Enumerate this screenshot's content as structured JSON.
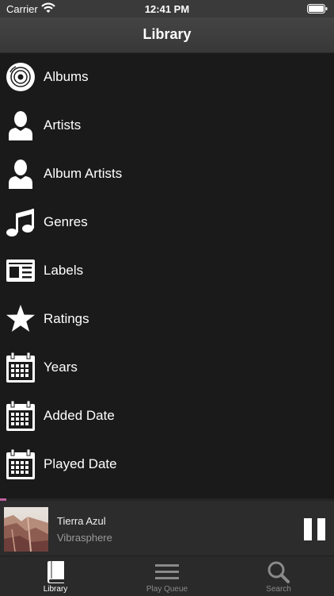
{
  "status_bar": {
    "carrier": "Carrier",
    "time": "12:41 PM"
  },
  "nav": {
    "title": "Library"
  },
  "list": {
    "items": [
      {
        "label": "Albums",
        "icon": "album-icon"
      },
      {
        "label": "Artists",
        "icon": "person-icon"
      },
      {
        "label": "Album Artists",
        "icon": "person-icon"
      },
      {
        "label": "Genres",
        "icon": "music-note-icon"
      },
      {
        "label": "Labels",
        "icon": "label-icon"
      },
      {
        "label": "Ratings",
        "icon": "star-icon"
      },
      {
        "label": "Years",
        "icon": "calendar-icon"
      },
      {
        "label": "Added Date",
        "icon": "calendar-icon"
      },
      {
        "label": "Played Date",
        "icon": "calendar-icon"
      }
    ]
  },
  "player": {
    "title": "Tierra Azul",
    "artist": "Vibrasphere",
    "progress": 0.02,
    "accent": "#c060a0"
  },
  "tabs": [
    {
      "label": "Library",
      "icon": "book-icon",
      "active": true
    },
    {
      "label": "Play Queue",
      "icon": "list-icon",
      "active": false
    },
    {
      "label": "Search",
      "icon": "search-icon",
      "active": false
    }
  ]
}
